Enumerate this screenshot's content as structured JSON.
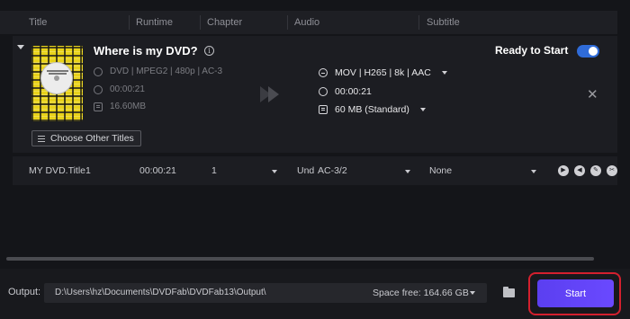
{
  "header": {
    "columns": [
      "Title",
      "Runtime",
      "Chapter",
      "Audio",
      "Subtitle"
    ]
  },
  "card": {
    "title": "Where is my DVD?",
    "info_icon": "info-icon",
    "source": {
      "format": "DVD | MPEG2 | 480p | AC-3",
      "duration": "00:00:21",
      "size": "16.60MB"
    },
    "output": {
      "format": "MOV | H265 | 8k | AAC",
      "duration": "00:00:21",
      "size": "60 MB (Standard)"
    },
    "status": "Ready to Start",
    "toggle_on": true,
    "choose_titles_label": "Choose Other Titles"
  },
  "track_row": {
    "title": "MY DVD.Title1",
    "runtime": "00:00:21",
    "chapter": "1",
    "audio_lang": "Und",
    "audio_codec": "AC-3/2",
    "subtitle": "None"
  },
  "footer": {
    "output_label": "Output:",
    "path": "D:\\Users\\hz\\Documents\\DVDFab\\DVDFab13\\Output\\",
    "space_free": "Space free: 164.66 GB",
    "start_label": "Start"
  },
  "colors": {
    "accent": "#6a49ff",
    "toggle": "#2f6bd8",
    "highlight_ring": "#d4202e"
  }
}
